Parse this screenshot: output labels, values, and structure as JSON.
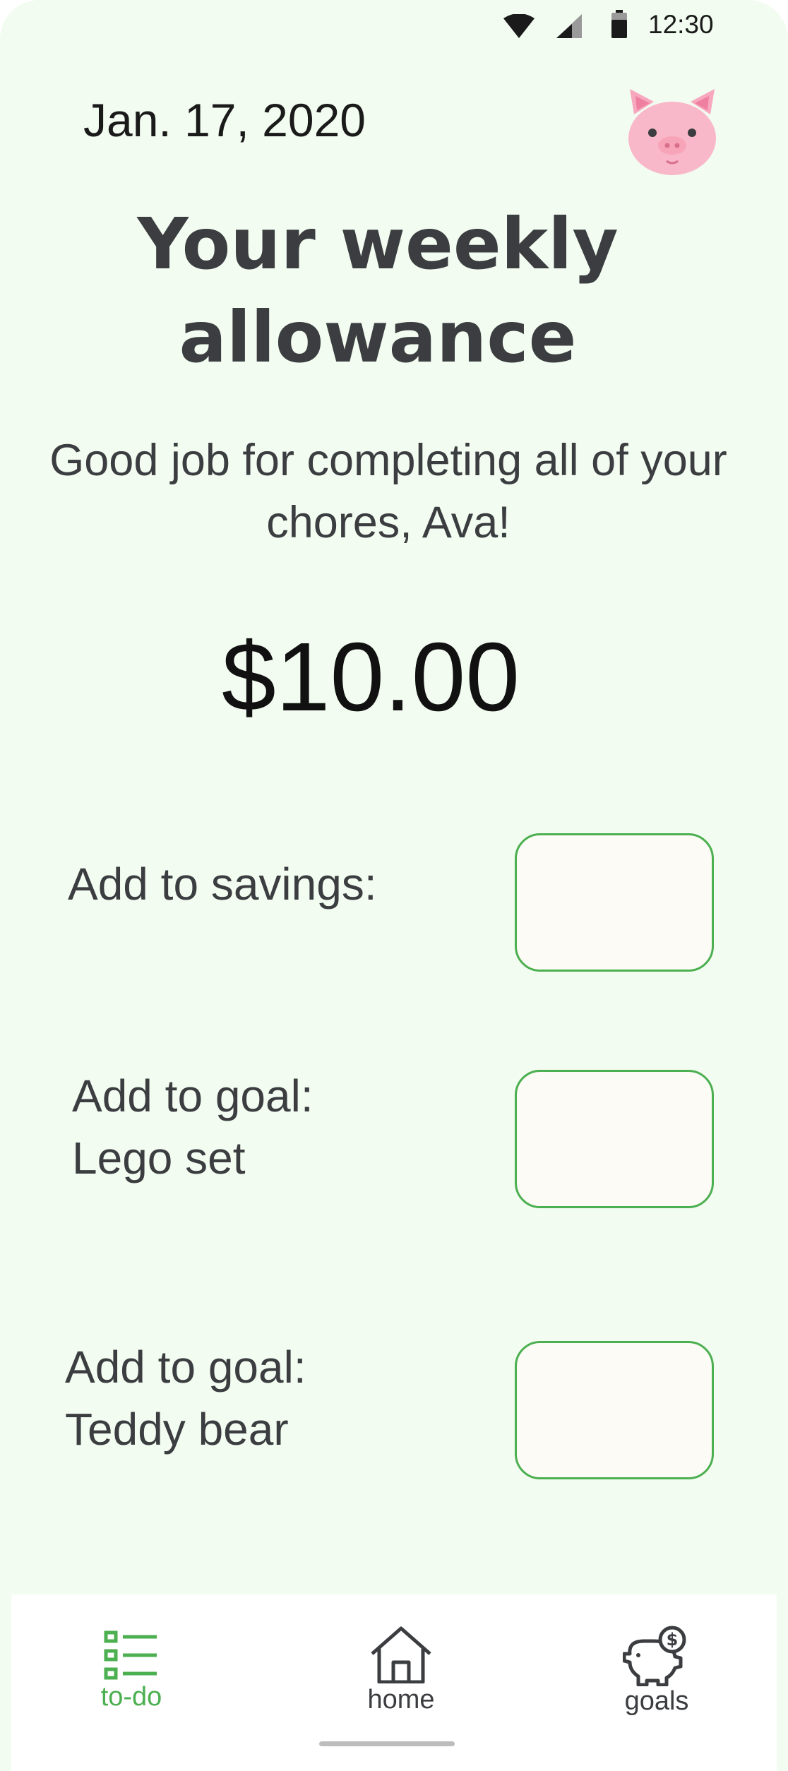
{
  "status_bar": {
    "time": "12:30"
  },
  "header": {
    "date": "Jan. 17, 2020",
    "avatar_icon": "pig-icon"
  },
  "title": "Your weekly allowance",
  "subtitle": "Good job for completing all of your chores, Ava!",
  "amount": "$10.00",
  "allocations": [
    {
      "label_line1": "Add to savings:",
      "label_line2": "",
      "value": ""
    },
    {
      "label_line1": "Add to goal:",
      "label_line2": "Lego set",
      "value": ""
    },
    {
      "label_line1": "Add to goal:",
      "label_line2": "Teddy bear",
      "value": ""
    }
  ],
  "nav": {
    "items": [
      {
        "label": "to-do",
        "icon": "checklist-icon",
        "active": true
      },
      {
        "label": "home",
        "icon": "home-icon",
        "active": false
      },
      {
        "label": "goals",
        "icon": "piggy-bank-icon",
        "active": false
      }
    ]
  },
  "colors": {
    "background": "#f2fcf0",
    "accent": "#4caf50",
    "text": "#3b3d40",
    "input_fill": "#fdfbf6"
  }
}
